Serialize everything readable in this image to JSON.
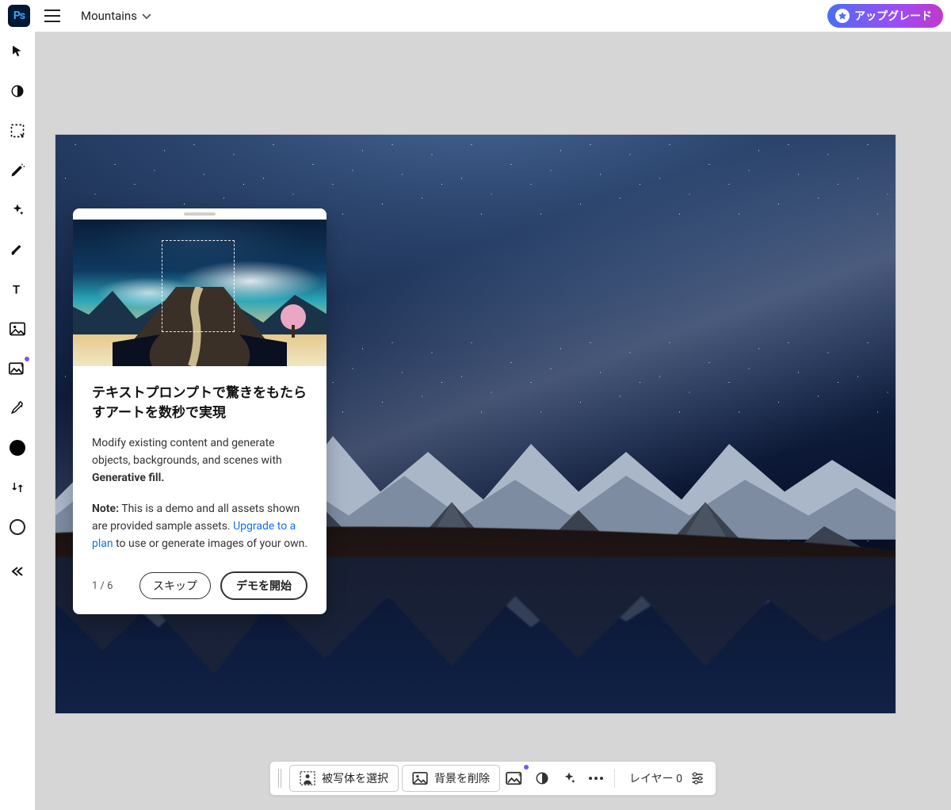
{
  "header": {
    "app_short": "Ps",
    "filename": "Mountains",
    "upgrade": "アップグレード"
  },
  "tools": {
    "move": "move-tool",
    "adjust": "adjust-tool",
    "select": "select-tool",
    "retouch": "retouch-tool",
    "gen": "generative-tool",
    "brush": "brush-tool",
    "text": "text-tool",
    "image": "image-tool",
    "genfill": "genfill-tool",
    "eyedrop": "eyedropper-tool"
  },
  "popover": {
    "title": "テキストプロンプトで驚きをもたらすアートを数秒で実現",
    "body_lead": "Modify existing content and generate objects, backgrounds, and scenes with ",
    "body_bold": "Generative fill.",
    "note_label": "Note:",
    "note_text_a": " This is a demo and all assets shown are provided sample assets. ",
    "note_link": "Upgrade to a plan",
    "note_text_b": " to use or generate images of your own.",
    "step": "1 / 6",
    "skip": "スキップ",
    "start": "デモを開始"
  },
  "actionbar": {
    "select_subject": "被写体を選択",
    "remove_bg": "背景を削除",
    "layer_label": "レイヤー 0"
  }
}
